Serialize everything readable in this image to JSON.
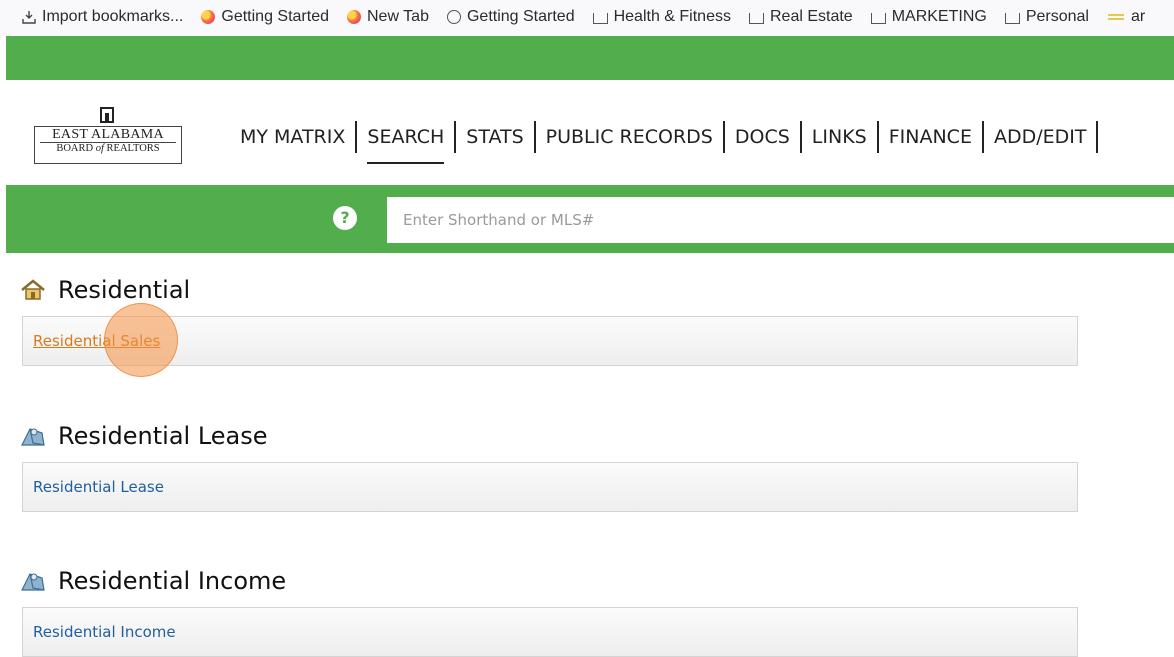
{
  "bookmarks": [
    {
      "label": "Import bookmarks...",
      "icon": "import-icon"
    },
    {
      "label": "Getting Started",
      "icon": "firefox-icon"
    },
    {
      "label": "New Tab",
      "icon": "firefox-icon"
    },
    {
      "label": "Getting Started",
      "icon": "globe-icon"
    },
    {
      "label": "Health & Fitness",
      "icon": "folder-icon"
    },
    {
      "label": "Real Estate",
      "icon": "folder-icon"
    },
    {
      "label": "MARKETING",
      "icon": "folder-icon"
    },
    {
      "label": "Personal",
      "icon": "folder-icon"
    },
    {
      "label": "ar",
      "icon": "overflow-icon"
    }
  ],
  "logo": {
    "line1": "EAST ALABAMA",
    "line2a": "BOARD",
    "line2b": "of",
    "line2c": "REALTORS"
  },
  "nav": [
    "MY MATRIX",
    "SEARCH",
    "STATS",
    "PUBLIC RECORDS",
    "DOCS",
    "LINKS",
    "FINANCE",
    "ADD/EDIT"
  ],
  "nav_active": "SEARCH",
  "search": {
    "placeholder": "Enter Shorthand or MLS#",
    "help": "?"
  },
  "sections": [
    {
      "title": "Residential",
      "link": "Residential Sales",
      "active": true
    },
    {
      "title": "Residential Lease",
      "link": "Residential Lease",
      "active": false
    },
    {
      "title": "Residential Income",
      "link": "Residential Income",
      "active": false
    }
  ],
  "colors": {
    "brand_green": "#52ad4c",
    "link_blue": "#1f5f9e",
    "link_active": "#d87a1e",
    "click_marker": "#f49142"
  }
}
